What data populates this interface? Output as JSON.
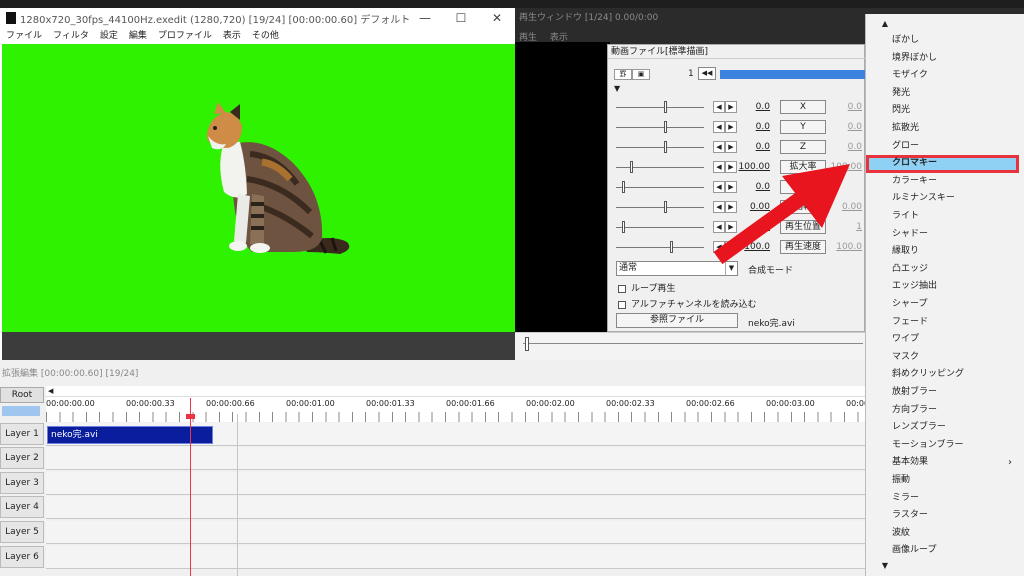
{
  "main_window": {
    "title": "1280x720_30fps_44100Hz.exedit (1280,720)  [19/24]  [00:00:00.60]  デフォルト",
    "minimize": "—",
    "maximize": "☐",
    "close": "✕",
    "menu": [
      "ファイル",
      "フィルタ",
      "設定",
      "編集",
      "プロファイル",
      "表示",
      "その他"
    ],
    "canvas_color": "#2ff200"
  },
  "play_window": {
    "title": "再生ウィンドウ  [1/24]  0.00/0:00",
    "menu": [
      "再生",
      "表示"
    ]
  },
  "props": {
    "title": "動画ファイル[標準描画]",
    "toolbar_left": "罫",
    "toolbar_right": "▣",
    "frame_number": "1",
    "rewind": "◀◀",
    "expand": "▼",
    "rows": [
      {
        "value": "0.0",
        "button": "X",
        "value2": "0.0"
      },
      {
        "value": "0.0",
        "button": "Y",
        "value2": "0.0"
      },
      {
        "value": "0.0",
        "button": "Z",
        "value2": "0.0"
      },
      {
        "value": "100.00",
        "button": "拡大率",
        "value2": "100.00"
      },
      {
        "value": "0.0",
        "button": "透明",
        "value2": ""
      },
      {
        "value": "0.00",
        "button": "回転",
        "value2": "0.00"
      },
      {
        "value": "1",
        "button": "再生位置",
        "value2": "1"
      },
      {
        "value": "100.0",
        "button": "再生速度",
        "value2": "100.0"
      }
    ],
    "blend_select": "通常",
    "blend_label": "合成モード",
    "loop_label": "ループ再生",
    "alpha_label": "アルファチャンネルを読み込む",
    "ref_button": "参照ファイル",
    "ref_file": "neko完.avi"
  },
  "timeline": {
    "title": "拡張編集 [00:00:00.60] [19/24]",
    "root": "Root",
    "times": [
      "00:00:00.00",
      "00:00:00.33",
      "00:00:00.66",
      "00:00:01.00",
      "00:00:01.33",
      "00:00:01.66",
      "00:00:02.00",
      "00:00:02.33",
      "00:00:02.66",
      "00:00:03.00",
      "00:00:0"
    ],
    "layers": [
      "Layer 1",
      "Layer 2",
      "Layer 3",
      "Layer 4",
      "Layer 5",
      "Layer 6"
    ],
    "clip_label": "neko完.avi"
  },
  "context_menu": {
    "up": "▲",
    "down": "▼",
    "submenu_arrow": "›",
    "items": [
      "ぼかし",
      "境界ぼかし",
      "モザイク",
      "発光",
      "閃光",
      "拡散光",
      "グロー",
      "クロマキー",
      "カラーキー",
      "ルミナンスキー",
      "ライト",
      "シャドー",
      "縁取り",
      "凸エッジ",
      "エッジ抽出",
      "シャープ",
      "フェード",
      "ワイプ",
      "マスク",
      "斜めクリッピング",
      "放射ブラー",
      "方向ブラー",
      "レンズブラー",
      "モーションブラー",
      "基本効果",
      "振動",
      "ミラー",
      "ラスター",
      "波紋",
      "画像ループ"
    ],
    "selected": "クロマキー"
  },
  "colors": {
    "highlight_border": "#e8323c",
    "arrow": "#e8141e",
    "clip": "#0a1d9c"
  }
}
